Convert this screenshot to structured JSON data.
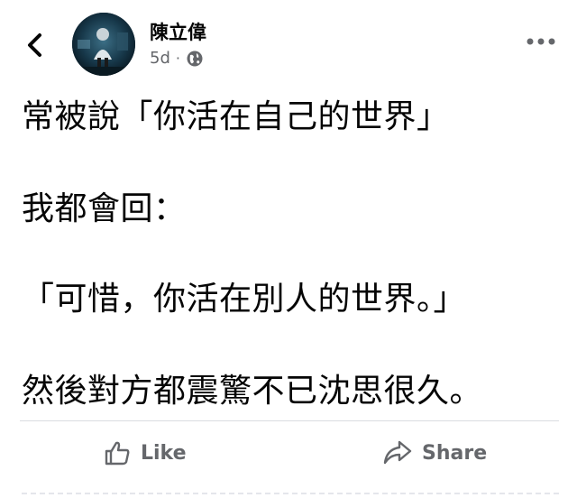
{
  "header": {
    "back_icon": "chevron-left-icon",
    "author_name": "陳立偉",
    "time": "5d",
    "separator": "·",
    "audience_icon": "globe-icon",
    "more_icon": "more-dots-icon"
  },
  "post": {
    "lines": [
      "常被說「你活在自己的世界」",
      "我都會回：",
      "「可惜，你活在別人的世界。」",
      "然後對方都震驚不已沈思很久。"
    ]
  },
  "actions": {
    "like_label": "Like",
    "like_icon": "thumbs-up-icon",
    "share_label": "Share",
    "share_icon": "share-arrow-icon"
  },
  "colors": {
    "text": "#050505",
    "muted": "#65676b",
    "divider": "#dadde1"
  }
}
